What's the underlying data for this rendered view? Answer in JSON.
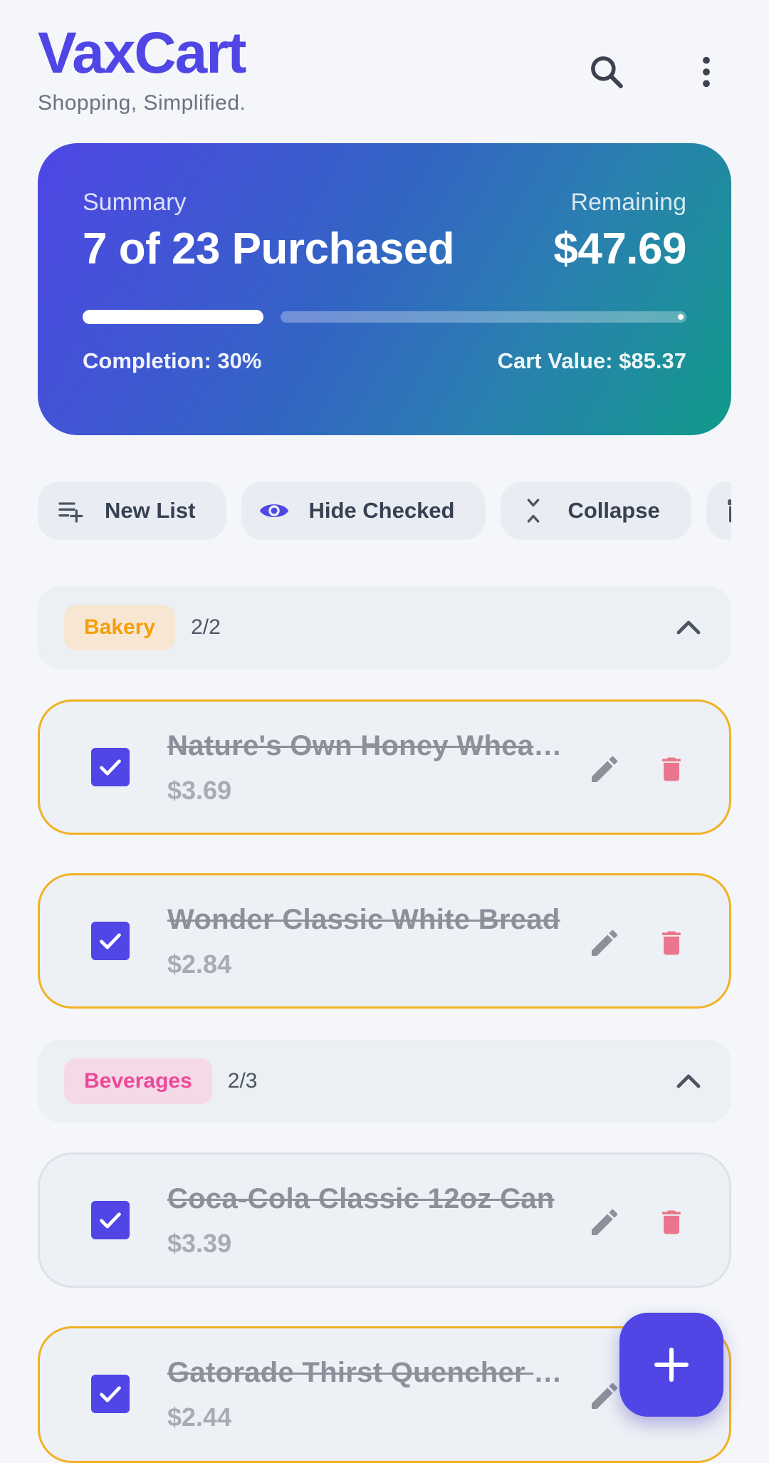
{
  "header": {
    "title": "VaxCart",
    "tagline": "Shopping, Simplified."
  },
  "summary": {
    "label": "Summary",
    "purchased_text": "7 of 23 Purchased",
    "remaining_label": "Remaining",
    "remaining_value": "$47.69",
    "completion_text": "Completion: 30%",
    "cart_value_text": "Cart Value: $85.37",
    "progress_fraction": 0.3
  },
  "chips": [
    {
      "label": "New List",
      "icon": "playlist-add-icon"
    },
    {
      "label": "Hide Checked",
      "icon": "eye-icon"
    },
    {
      "label": "Collapse",
      "icon": "collapse-icon"
    },
    {
      "label": "",
      "icon": "archive-icon"
    }
  ],
  "categories": [
    {
      "name": "Bakery",
      "count": "2/2",
      "badge_bg": "#f7e7d2",
      "badge_color": "#f59e0b",
      "items": [
        {
          "name": "Nature's Own Honey Wheat Bread",
          "price": "$3.69",
          "checked": true
        },
        {
          "name": "Wonder Classic White Bread",
          "price": "$2.84",
          "checked": true
        }
      ]
    },
    {
      "name": "Beverages",
      "count": "2/3",
      "badge_bg": "#f5d9e6",
      "badge_color": "#ec4899",
      "items": [
        {
          "name": "Coca-Cola Classic 12oz Can",
          "price": "$3.39",
          "checked": true
        },
        {
          "name": "Gatorade Thirst Quencher Fruit Punch",
          "price": "$2.44",
          "checked": true
        }
      ]
    }
  ],
  "colors": {
    "accent": "#4f46e5",
    "delete": "#e8778c",
    "highlight_border": "#f2b122"
  }
}
